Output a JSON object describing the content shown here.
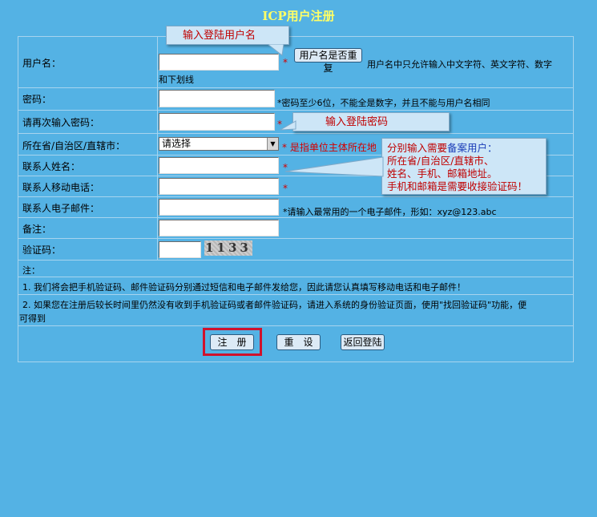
{
  "page_title": "ICP用户注册",
  "fields": {
    "username": {
      "label": "用户名：",
      "value": "",
      "required_mark": "*",
      "check_button": "用户名是否重复",
      "hint_line1": "用户名中只允许输入中文字符、英文字符、数字",
      "hint_line2": "和下划线"
    },
    "password": {
      "label": "密码：",
      "value": "",
      "hint": "*密码至少6位，不能全是数字，并且不能与用户名相同"
    },
    "password_confirm": {
      "label": "请再次输入密码：",
      "value": "",
      "required_mark": "*"
    },
    "province": {
      "label": "所在省/自治区/直辖市：",
      "selected": "请选择",
      "hint": "* 是指单位主体所在地"
    },
    "contact_name": {
      "label": "联系人姓名：",
      "value": "",
      "required_mark": "*"
    },
    "contact_mobile": {
      "label": "联系人移动电话：",
      "value": "",
      "required_mark": "*"
    },
    "contact_email": {
      "label": "联系人电子邮件：",
      "value": "",
      "hint": "*请输入最常用的一个电子邮件，形如：xyz@123.abc"
    },
    "remark": {
      "label": "备注：",
      "value": ""
    },
    "captcha": {
      "label": "验证码：",
      "value": "",
      "image_text": "1133"
    }
  },
  "notes": {
    "heading": "注：",
    "note1": "1. 我们将会把手机验证码、邮件验证码分别通过短信和电子邮件发给您，因此请您认真填写移动电话和电子邮件！",
    "note2_line1": "2. 如果您在注册后较长时间里仍然没有收到手机验证码或者邮件验证码，请进入系统的身份验证页面，使用\"找回验证码\"功能，便",
    "note2_line2": "可得到"
  },
  "buttons": {
    "register": "注　册",
    "reset": "重　设",
    "back_login": "返回登陆"
  },
  "callouts": {
    "username_tip": "输入登陆用户名",
    "password_tip": "输入登陆密码",
    "contact_tip_line1_a": "分别输入需要",
    "contact_tip_line1_b": "备案用户：",
    "contact_tip_line2": "所在省/自治区/直辖市、",
    "contact_tip_line3": "姓名、手机、邮箱地址。",
    "contact_tip_line4": "手机和邮箱是需要收接验证码！"
  },
  "colors": {
    "background": "#54b2e4",
    "title": "#ffff66",
    "required": "#d40000",
    "highlight_box": "#d0122c"
  }
}
